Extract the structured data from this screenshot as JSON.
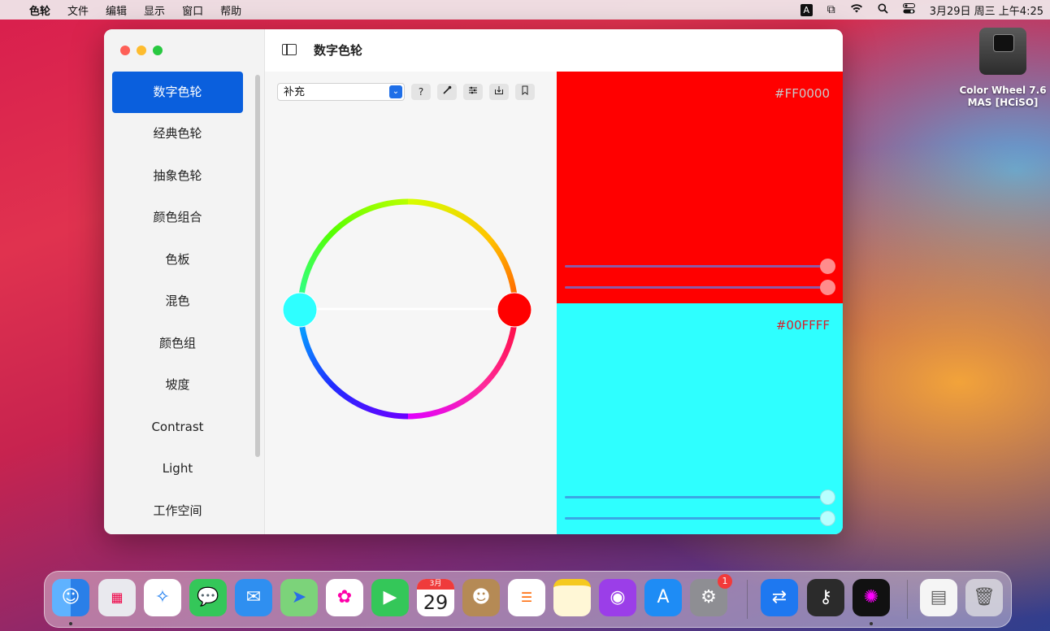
{
  "menubar": {
    "app": "色轮",
    "items": [
      "文件",
      "编辑",
      "显示",
      "窗口",
      "帮助"
    ],
    "input_indicator": "A",
    "clock": "3月29日 周三 上午4:25"
  },
  "window": {
    "title": "数字色轮",
    "sidebar": [
      "数字色轮",
      "经典色轮",
      "抽象色轮",
      "颜色组合",
      "色板",
      "混色",
      "颜色组",
      "坡度",
      "Contrast",
      "Light",
      "工作空间"
    ],
    "mode_select": "补充",
    "help_label": "?",
    "swatches": [
      {
        "hex": "#FF0000",
        "color": "#ff0000"
      },
      {
        "hex": "#00FFFF",
        "color": "#2effff"
      }
    ]
  },
  "desktop_icon": {
    "label_line1": "Color Wheel 7.6",
    "label_line2": "MAS [HCiSO]"
  },
  "dock": {
    "calendar_month": "3月",
    "calendar_day": "29",
    "settings_badge": "1",
    "icons": [
      "finder-icon",
      "launchpad-icon",
      "safari-icon",
      "messages-icon",
      "mail-icon",
      "maps-icon",
      "photos-icon",
      "facetime-icon",
      "calendar-icon",
      "contacts-icon",
      "reminders-icon",
      "notes-icon",
      "podcasts-icon",
      "appstore-icon",
      "system-preferences-icon",
      "teamviewer-icon",
      "keychain-icon",
      "color-wheel-icon",
      "preview-icon",
      "trash-icon"
    ]
  }
}
